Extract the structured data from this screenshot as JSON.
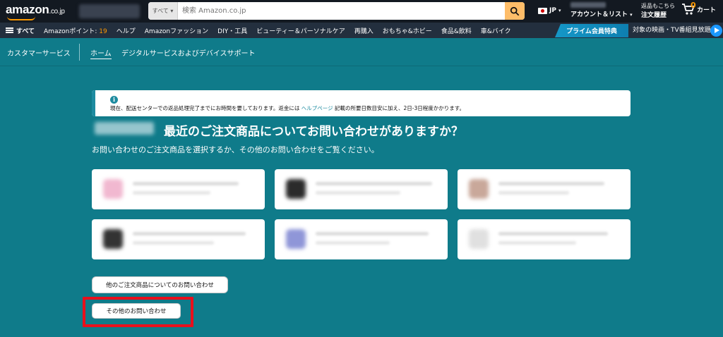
{
  "header": {
    "logo": "amazon",
    "logo_tld": ".co.jp",
    "search_category": "すべて",
    "search_placeholder": "検索 Amazon.co.jp",
    "language": "JP",
    "account_label": "アカウント＆リスト",
    "orders_small": "返品もこちら",
    "orders_big": "注文履歴",
    "cart_count": "0",
    "cart_label": "カート"
  },
  "subnav": {
    "all": "すべて",
    "points_label": "Amazonポイント:",
    "points_value": "19",
    "items": [
      "ヘルプ",
      "Amazonファッション",
      "DIY・工具",
      "ビューティー＆パーソナルケア",
      "再購入",
      "おもちゃ&ホビー",
      "食品&飲料",
      "車&バイク"
    ],
    "prime_banner": "プライム会員特典",
    "prime_tv": "対象の映画・TV番組見放題"
  },
  "cs_nav": {
    "title": "カスタマーサービス",
    "home": "ホーム",
    "digital": "デジタルサービスおよびデバイスサポート"
  },
  "info": {
    "icon": "i",
    "msg_pre": "現在、配送センターでの返品処理完了までにお時間を要しております。返金には ",
    "msg_link": "ヘルプページ",
    "msg_post": " 記載の所要日数目安に加え、2日-3日程度かかります。"
  },
  "main": {
    "heading": "最近のご注文商品についてお問い合わせがありますか？",
    "subheading": "お問い合わせのご注文商品を選択するか、その他のお問い合わせをご覧ください。",
    "other_orders_button": "他のご注文商品についてのお問い合わせ",
    "other_inquiry_button": "その他のお問い合わせ"
  },
  "colors": {
    "nav_dark": "#131921",
    "subnav": "#232f3e",
    "teal_bg": "#0f7b8a",
    "accent_orange": "#ff9900",
    "highlight_red": "#e8101c"
  }
}
